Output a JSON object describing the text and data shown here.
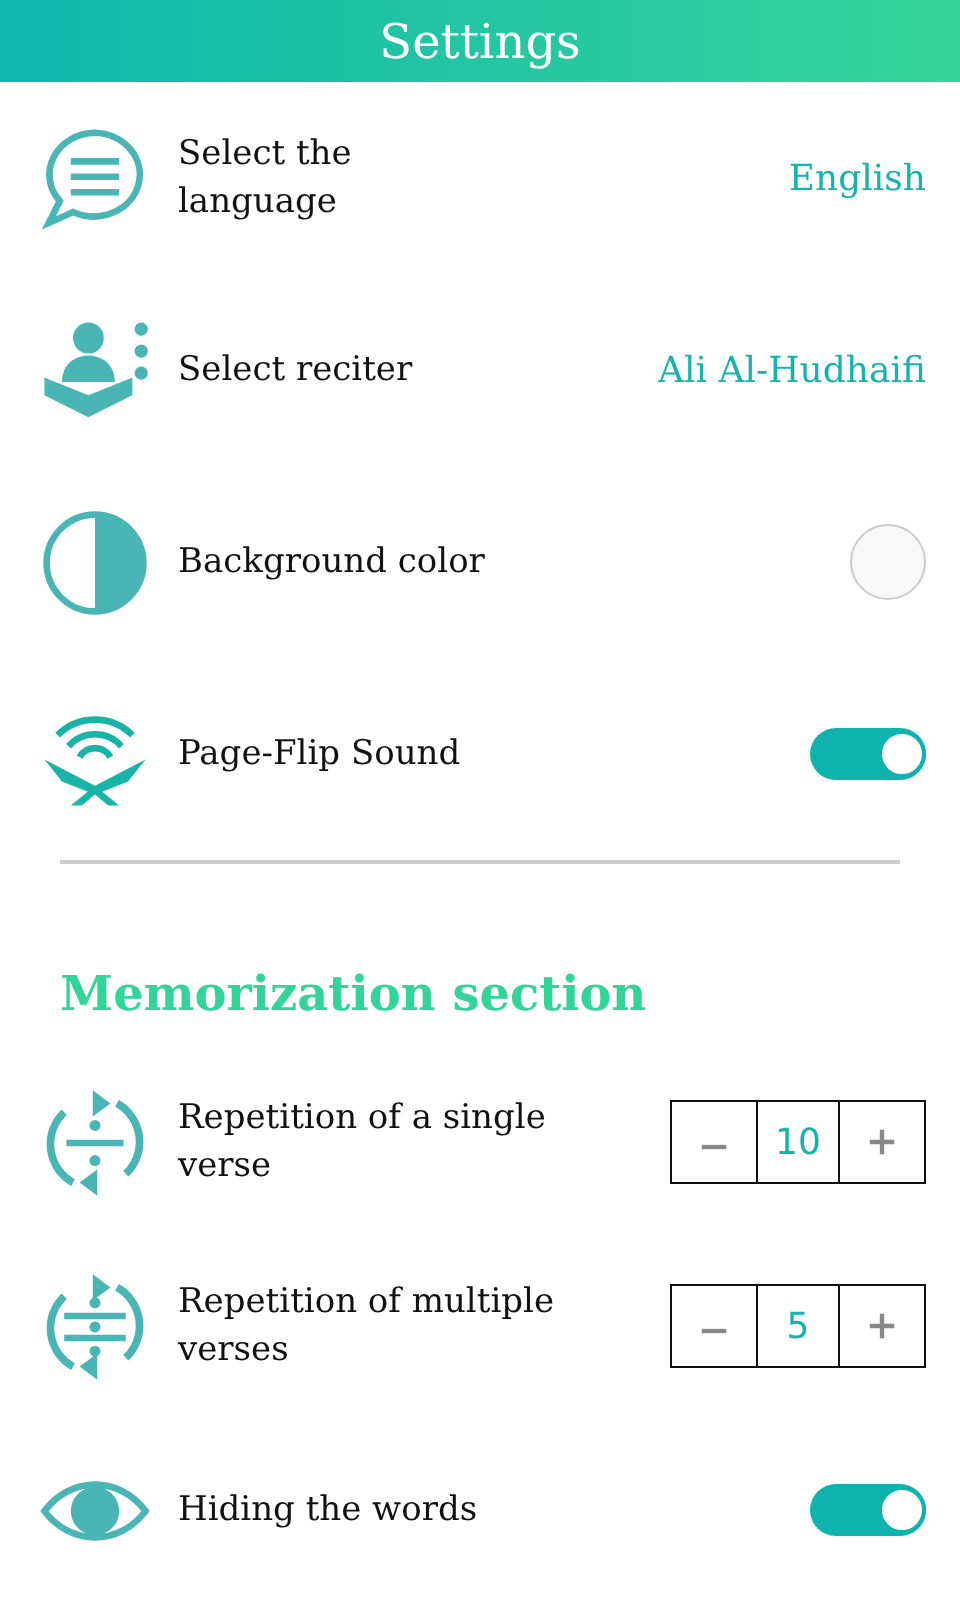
{
  "header": {
    "title": "Settings"
  },
  "general": [
    {
      "kind": "value",
      "label": "Select the language",
      "value": "English"
    },
    {
      "kind": "value",
      "label": "Select reciter",
      "value": "Ali Al-Hudhaifi"
    },
    {
      "kind": "color",
      "label": "Background color",
      "color": "#f8f8f8"
    },
    {
      "kind": "toggle",
      "label": "Page-Flip Sound",
      "on": true
    }
  ],
  "memorization": {
    "title": "Memorization section",
    "items": [
      {
        "kind": "stepper",
        "label": "Repetition of a single verse",
        "value": "10"
      },
      {
        "kind": "stepper",
        "label": "Repetition of multiple verses",
        "value": "5"
      },
      {
        "kind": "toggle",
        "label": "Hiding the words",
        "on": true
      }
    ]
  }
}
